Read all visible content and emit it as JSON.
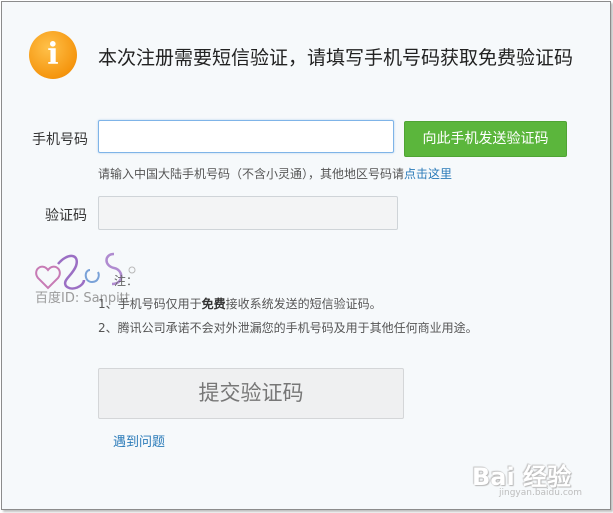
{
  "notice": {
    "icon": "info-icon",
    "icon_glyph": "i",
    "title": "本次注册需要短信验证，请填写手机号码获取免费验证码"
  },
  "form": {
    "phone_label": "手机号码",
    "phone_value": "",
    "send_button_label": "向此手机发送验证码",
    "hint_text": "请输入中国大陆手机号码（不含小灵通），其他地区号码请",
    "hint_link": "点击这里",
    "code_label": "验证码",
    "code_value": ""
  },
  "watermark": {
    "text": "百度ID: Sanpitt"
  },
  "notes": {
    "head": "注：",
    "item1_prefix": "1、手机号码仅用于",
    "item1_bold": "免费",
    "item1_suffix": "接收系统发送的短信验证码。",
    "item2": "2、腾讯公司承诺不会对外泄漏您的手机号码及用于其他任何商业用途。"
  },
  "actions": {
    "submit_label": "提交验证码",
    "trouble_link": "遇到问题"
  },
  "branding": {
    "logo_text": "Bai 经验",
    "logo_sub": "jingyan.baidu.com"
  },
  "colors": {
    "accent_green": "#5bb63c",
    "link_blue": "#2b7bb9",
    "icon_orange": "#f5960f"
  }
}
